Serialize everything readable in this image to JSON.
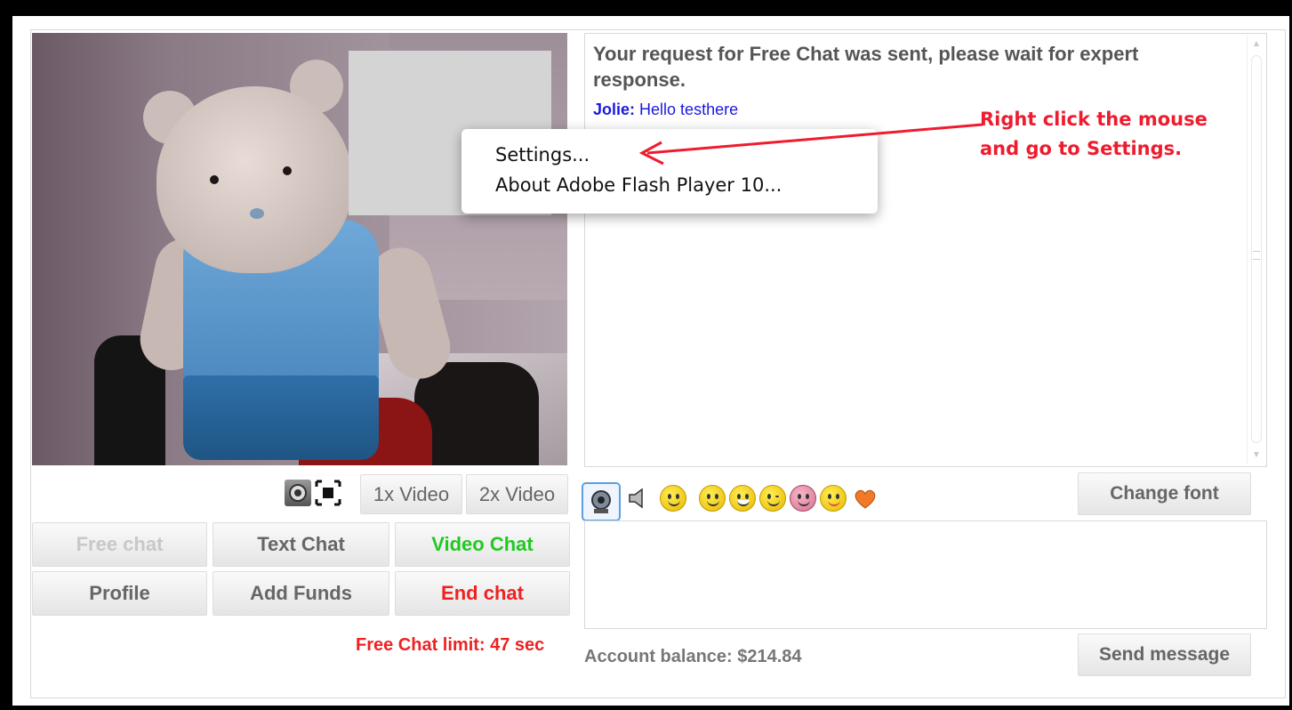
{
  "chat": {
    "system_message": "Your request for Free Chat was sent, please wait for expert response.",
    "messages": [
      {
        "sender": "Jolie:",
        "text": "Hello testhere"
      }
    ]
  },
  "context_menu": {
    "items": [
      "Settings...",
      "About Adobe Flash Player 10..."
    ]
  },
  "annotation": {
    "line1": "Right click the mouse",
    "line2": "and go to Settings.",
    "color": "#ee1c2e"
  },
  "video_toolbar": {
    "icons": [
      "webcam-settings-icon",
      "fullscreen-icon"
    ],
    "buttons": [
      "1x Video",
      "2x Video"
    ]
  },
  "actions": {
    "free_chat": "Free chat",
    "text_chat": "Text Chat",
    "video_chat": "Video Chat",
    "profile": "Profile",
    "add_funds": "Add Funds",
    "end_chat": "End chat"
  },
  "emoticon_bar": {
    "icons": [
      "camera-icon",
      "sound-icon",
      "smiley-menu-icon",
      "smile-icon",
      "grin-icon",
      "wink-icon",
      "blush-icon",
      "tongue-icon",
      "heart-icon"
    ],
    "change_font": "Change font"
  },
  "footer": {
    "free_chat_limit": "Free Chat limit: 47 sec",
    "account_balance": "Account balance: $214.84",
    "send_message": "Send message"
  },
  "colors": {
    "accent_red": "#ee2222",
    "accent_green": "#22c922",
    "link_blue": "#1a1ae0"
  }
}
